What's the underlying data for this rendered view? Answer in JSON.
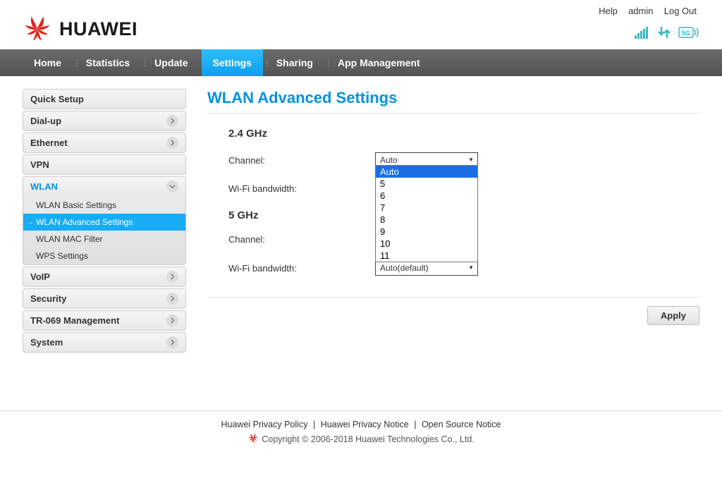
{
  "topbar": {
    "help": "Help",
    "user": "admin",
    "logout": "Log Out"
  },
  "brand": "HUAWEI",
  "nav": {
    "items": [
      "Home",
      "Statistics",
      "Update",
      "Settings",
      "Sharing",
      "App Management"
    ],
    "active_index": 3
  },
  "sidebar": [
    {
      "label": "Quick Setup",
      "expandable": false
    },
    {
      "label": "Dial-up",
      "expandable": true
    },
    {
      "label": "Ethernet",
      "expandable": true
    },
    {
      "label": "VPN",
      "expandable": false
    },
    {
      "label": "WLAN",
      "expandable": true,
      "active": true,
      "children": [
        {
          "label": "WLAN Basic Settings"
        },
        {
          "label": "WLAN Advanced Settings",
          "active": true
        },
        {
          "label": "WLAN MAC Filter"
        },
        {
          "label": "WPS Settings"
        }
      ]
    },
    {
      "label": "VoIP",
      "expandable": true
    },
    {
      "label": "Security",
      "expandable": true
    },
    {
      "label": "TR-069 Management",
      "expandable": true
    },
    {
      "label": "System",
      "expandable": true
    }
  ],
  "content": {
    "page_title": "WLAN Advanced Settings",
    "band24": {
      "title": "2.4 GHz",
      "channel_label": "Channel:",
      "channel_value": "Auto",
      "channel_options": [
        "Auto",
        "5",
        "6",
        "7",
        "8",
        "9",
        "10",
        "11"
      ],
      "channel_selected_index": 0,
      "bandwidth_label": "Wi-Fi bandwidth:"
    },
    "band5": {
      "title": "5 GHz",
      "channel_label": "Channel:",
      "bandwidth_label": "Wi-Fi bandwidth:",
      "bandwidth_value": "Auto(default)"
    },
    "apply": "Apply"
  },
  "footer": {
    "links": [
      "Huawei Privacy Policy",
      "Huawei Privacy Notice",
      "Open Source Notice"
    ],
    "copyright": "Copyright © 2006-2018 Huawei Technologies Co., Ltd."
  },
  "colors": {
    "brand_red": "#e2231a",
    "primary_blue": "#0093dd",
    "selection_blue": "#1a6fe6",
    "tab_blue": "#18acf5",
    "status_teal": "#3ab8c7"
  }
}
